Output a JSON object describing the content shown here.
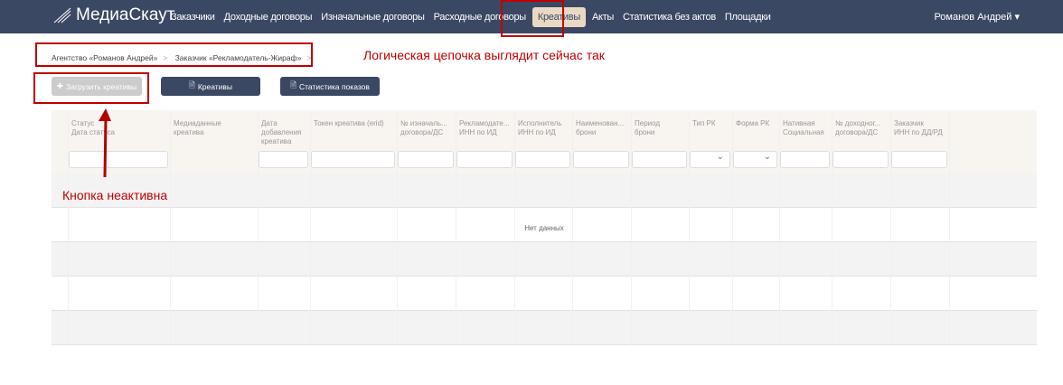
{
  "nav": {
    "logo": "МедиаСкаут",
    "items": [
      "Заказчики",
      "Доходные договоры",
      "Изначальные договоры",
      "Расходные договоры",
      "Креативы",
      "Акты",
      "Статистика без актов",
      "Площадки"
    ],
    "active": "Креативы",
    "user": "Романов Андрей"
  },
  "breadcrumb": [
    "Агентство «Романов Андрей»",
    "Заказчик «Рекламодатель-Жираф»"
  ],
  "buttons": {
    "upload": "Загрузить креативы",
    "creatives": "Креативы",
    "stats": "Статистика показов"
  },
  "columns": [
    "Статус\nДата статуса",
    "Медиаданные\nкреатива",
    "Дата\nдобавления\nкреатива",
    "Токен креатива (erid)",
    "№ изначаль...\nдоговора/ДС",
    "Рекламодате...\nИНН по ИД",
    "Исполнитель\nИНН по ИД",
    "Наименован...\nброни",
    "Период\nброни",
    "Тип РК",
    "Форма РК",
    "Нативная\nСоциальная",
    "№ доходног...\nдоговора/ДС",
    "Заказчик\nИНН по ДД/РД"
  ],
  "empty": "Нет данных",
  "annotations": {
    "chain": "Логическая цепочка выглядит сейчас так",
    "inactive": "Кнопка неактивна"
  }
}
